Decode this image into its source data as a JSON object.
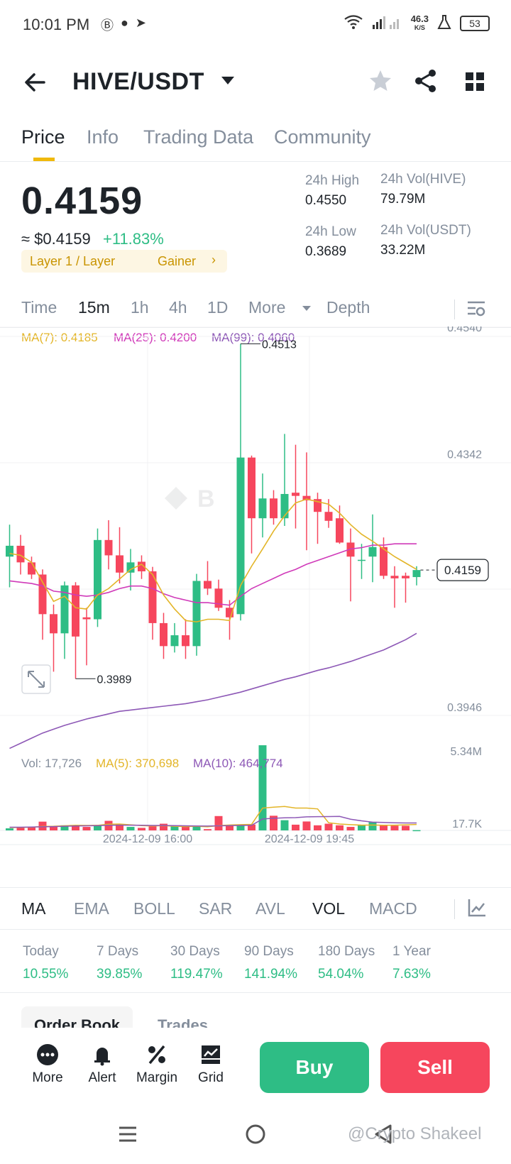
{
  "status_bar": {
    "time": "10:01 PM",
    "net_speed": "46.3",
    "net_unit": "K/S",
    "battery": "53"
  },
  "header": {
    "pair": "HIVE/USDT"
  },
  "tabs": [
    "Price",
    "Info",
    "Trading Data",
    "Community"
  ],
  "price": {
    "last": "0.4159",
    "usd": "≈ $0.4159",
    "change": "+11.83%",
    "tag_1": "Layer 1 / Layer",
    "tag_2": "Gainer",
    "tag_arrow": "›"
  },
  "stats": {
    "high_label": "24h High",
    "high_value": "0.4550",
    "low_label": "24h Low",
    "low_value": "0.3689",
    "vol_base_label": "24h Vol(HIVE)",
    "vol_base_value": "79.79M",
    "vol_quote_label": "24h Vol(USDT)",
    "vol_quote_value": "33.22M"
  },
  "intervals": [
    "Time",
    "15m",
    "1h",
    "4h",
    "1D",
    "More",
    "Depth"
  ],
  "active_interval": "15m",
  "ma_legend": {
    "ma7": "MA(7): 0.4185",
    "ma25": "MA(25): 0.4200",
    "ma99": "MA(99): 0.4060"
  },
  "vol_legend": {
    "vol": "Vol: 17,726",
    "ma5": "MA(5): 370,698",
    "ma10": "MA(10): 464,774"
  },
  "chart_data": {
    "type": "candlestick",
    "price_axis_ticks": [
      "0.4540",
      "0.4342",
      "0.3946"
    ],
    "ylim": [
      0.388,
      0.454
    ],
    "last_price_label": "0.4159",
    "last_price": 0.4159,
    "high_marker": {
      "label": "0.4513",
      "value": 0.4513
    },
    "low_marker": {
      "label": "0.3989",
      "value": 0.3989
    },
    "time_labels": [
      "2024-12-09 16:00",
      "2024-12-09 19:45"
    ],
    "vol_axis_ticks": [
      "5.34M",
      "17.7K"
    ],
    "vol_max": 5340000,
    "colors": {
      "up": "#2ebd85",
      "down": "#f6465d",
      "ma7": "#e3b528",
      "ma25": "#d03ab9",
      "ma99": "#8d58b6"
    },
    "candles": [
      [
        0.418,
        0.423,
        0.4132,
        0.4197
      ],
      [
        0.4197,
        0.4214,
        0.4152,
        0.4171
      ],
      [
        0.4171,
        0.418,
        0.4145,
        0.4152
      ],
      [
        0.4152,
        0.416,
        0.405,
        0.409
      ],
      [
        0.409,
        0.4105,
        0.4,
        0.406
      ],
      [
        0.406,
        0.4141,
        0.402,
        0.4135
      ],
      [
        0.4135,
        0.414,
        0.3989,
        0.4055
      ],
      [
        0.4085,
        0.41,
        0.401,
        0.4082
      ],
      [
        0.4082,
        0.4224,
        0.407,
        0.4206
      ],
      [
        0.4206,
        0.4237,
        0.416,
        0.4182
      ],
      [
        0.4182,
        0.4226,
        0.4138,
        0.4155
      ],
      [
        0.4155,
        0.4192,
        0.4127,
        0.4171
      ],
      [
        0.4172,
        0.4182,
        0.4145,
        0.4157
      ],
      [
        0.4157,
        0.4164,
        0.405,
        0.4076
      ],
      [
        0.4076,
        0.4092,
        0.402,
        0.404
      ],
      [
        0.404,
        0.4076,
        0.403,
        0.4057
      ],
      [
        0.4057,
        0.4082,
        0.402,
        0.404
      ],
      [
        0.404,
        0.4153,
        0.4025,
        0.4142
      ],
      [
        0.4142,
        0.4173,
        0.412,
        0.413
      ],
      [
        0.413,
        0.4144,
        0.4095,
        0.41
      ],
      [
        0.41,
        0.4112,
        0.405,
        0.4085
      ],
      [
        0.409,
        0.4513,
        0.408,
        0.4335
      ],
      [
        0.4335,
        0.4338,
        0.4185,
        0.424
      ],
      [
        0.424,
        0.431,
        0.421,
        0.4271
      ],
      [
        0.4271,
        0.4284,
        0.423,
        0.424
      ],
      [
        0.424,
        0.4372,
        0.4228,
        0.4278
      ],
      [
        0.428,
        0.4355,
        0.4224,
        0.4275
      ],
      [
        0.4275,
        0.4343,
        0.419,
        0.4268
      ],
      [
        0.427,
        0.428,
        0.42,
        0.425
      ],
      [
        0.425,
        0.427,
        0.4225,
        0.4236
      ],
      [
        0.424,
        0.426,
        0.42,
        0.4202
      ],
      [
        0.4202,
        0.4224,
        0.411,
        0.418
      ],
      [
        0.4175,
        0.42,
        0.4145,
        0.4175
      ],
      [
        0.418,
        0.4246,
        0.414,
        0.4195
      ],
      [
        0.4195,
        0.421,
        0.4145,
        0.415
      ],
      [
        0.415,
        0.4165,
        0.41,
        0.4146
      ],
      [
        0.415,
        0.4155,
        0.4108,
        0.4146
      ],
      [
        0.4148,
        0.4165,
        0.4135,
        0.4159
      ]
    ],
    "ma7": [
      0.4185,
      0.4182,
      0.4171,
      0.414,
      0.411,
      0.4118,
      0.41,
      0.4098,
      0.412,
      0.413,
      0.4145,
      0.416,
      0.4168,
      0.4152,
      0.412,
      0.4098,
      0.408,
      0.4078,
      0.4082,
      0.4082,
      0.408,
      0.4135,
      0.4165,
      0.4192,
      0.422,
      0.4244,
      0.4264,
      0.427,
      0.4266,
      0.4262,
      0.4248,
      0.423,
      0.4215,
      0.4204,
      0.4192,
      0.418,
      0.417,
      0.416
    ],
    "ma25": [
      0.4142,
      0.414,
      0.4138,
      0.4134,
      0.4126,
      0.4124,
      0.412,
      0.4118,
      0.412,
      0.4124,
      0.413,
      0.4134,
      0.4134,
      0.413,
      0.4122,
      0.4116,
      0.4112,
      0.4108,
      0.4108,
      0.4106,
      0.4104,
      0.4118,
      0.413,
      0.4138,
      0.4146,
      0.4154,
      0.416,
      0.4168,
      0.4174,
      0.418,
      0.4186,
      0.4192,
      0.4194,
      0.4198,
      0.4198,
      0.42,
      0.42,
      0.42
    ],
    "ma99": [
      0.388,
      0.3888,
      0.3896,
      0.3904,
      0.391,
      0.3916,
      0.3921,
      0.3926,
      0.393,
      0.3934,
      0.3938,
      0.394,
      0.3942,
      0.3944,
      0.3946,
      0.3948,
      0.395,
      0.3953,
      0.3956,
      0.396,
      0.3964,
      0.3968,
      0.3973,
      0.3978,
      0.3983,
      0.3988,
      0.3992,
      0.3997,
      0.4002,
      0.4006,
      0.4011,
      0.4016,
      0.4022,
      0.4028,
      0.4034,
      0.4042,
      0.405,
      0.406
    ],
    "volumes": [
      130000,
      160000,
      180000,
      550000,
      220000,
      320000,
      280000,
      220000,
      330000,
      600000,
      400000,
      220000,
      160000,
      260000,
      420000,
      250000,
      250000,
      250000,
      80000,
      900000,
      320000,
      330000,
      370000,
      5340000,
      920000,
      640000,
      360000,
      560000,
      320000,
      420000,
      320000,
      220000,
      310000,
      540000,
      330000,
      300000,
      290000,
      17726
    ],
    "vol_ma5": [
      180000,
      190000,
      200000,
      250000,
      260000,
      290000,
      320000,
      310000,
      320000,
      390000,
      400000,
      350000,
      300000,
      280000,
      300000,
      260000,
      240000,
      260000,
      230000,
      300000,
      340000,
      360000,
      380000,
      1400000,
      1460000,
      1500000,
      1400000,
      1400000,
      1350000,
      480000,
      400000,
      360000,
      330000,
      340000,
      320000,
      330000,
      350000,
      370698
    ],
    "vol_ma10": [
      200000,
      200000,
      210000,
      230000,
      240000,
      260000,
      280000,
      290000,
      300000,
      320000,
      330000,
      330000,
      320000,
      310000,
      310000,
      300000,
      290000,
      280000,
      270000,
      290000,
      300000,
      310000,
      320000,
      720000,
      760000,
      790000,
      800000,
      850000,
      860000,
      870000,
      880000,
      700000,
      600000,
      520000,
      500000,
      480000,
      470000,
      464774
    ]
  },
  "indicators": [
    "MA",
    "EMA",
    "BOLL",
    "SAR",
    "AVL",
    "VOL",
    "MACD"
  ],
  "performance": [
    {
      "label": "Today",
      "value": "10.55%"
    },
    {
      "label": "7 Days",
      "value": "39.85%"
    },
    {
      "label": "30 Days",
      "value": "119.47%"
    },
    {
      "label": "90 Days",
      "value": "141.94%"
    },
    {
      "label": "180 Days",
      "value": "54.04%"
    },
    {
      "label": "1 Year",
      "value": "7.63%"
    }
  ],
  "order_tabs": [
    "Order Book",
    "Trades"
  ],
  "bottom_bar": {
    "more": "More",
    "alert": "Alert",
    "margin": "Margin",
    "grid": "Grid",
    "buy": "Buy",
    "sell": "Sell"
  },
  "watermark": "@Crypto Shakeel"
}
